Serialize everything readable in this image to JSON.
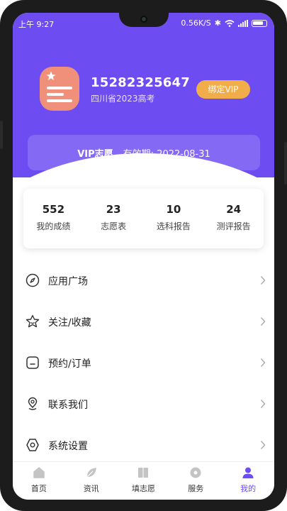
{
  "status_bar": {
    "time": "上午 9:27",
    "speed": "0.56K/S"
  },
  "profile": {
    "phone": "15282325647",
    "subtitle": "四川省2023高考",
    "bind_vip_label": "绑定VIP"
  },
  "vip_card": {
    "title": "VIP志愿",
    "validity_label": "有效期:",
    "validity_date": "2022-08-31"
  },
  "stats": [
    {
      "value": "552",
      "label": "我的成绩"
    },
    {
      "value": "23",
      "label": "志愿表"
    },
    {
      "value": "10",
      "label": "选科报告"
    },
    {
      "value": "24",
      "label": "测评报告"
    }
  ],
  "menu": [
    {
      "label": "应用广场",
      "icon": "compass-icon"
    },
    {
      "label": "关注/收藏",
      "icon": "star-icon"
    },
    {
      "label": "预约/订单",
      "icon": "order-icon"
    },
    {
      "label": "联系我们",
      "icon": "location-icon"
    },
    {
      "label": "系统设置",
      "icon": "settings-icon"
    }
  ],
  "bottom_nav": [
    {
      "label": "首页",
      "icon": "home-icon"
    },
    {
      "label": "资讯",
      "icon": "news-icon"
    },
    {
      "label": "填志愿",
      "icon": "book-icon"
    },
    {
      "label": "服务",
      "icon": "service-icon"
    },
    {
      "label": "我的",
      "icon": "user-icon",
      "active": true
    }
  ],
  "colors": {
    "accent": "#6d4cf2",
    "vip_button": "#f2ad4b",
    "avatar": "#f08f7a"
  }
}
